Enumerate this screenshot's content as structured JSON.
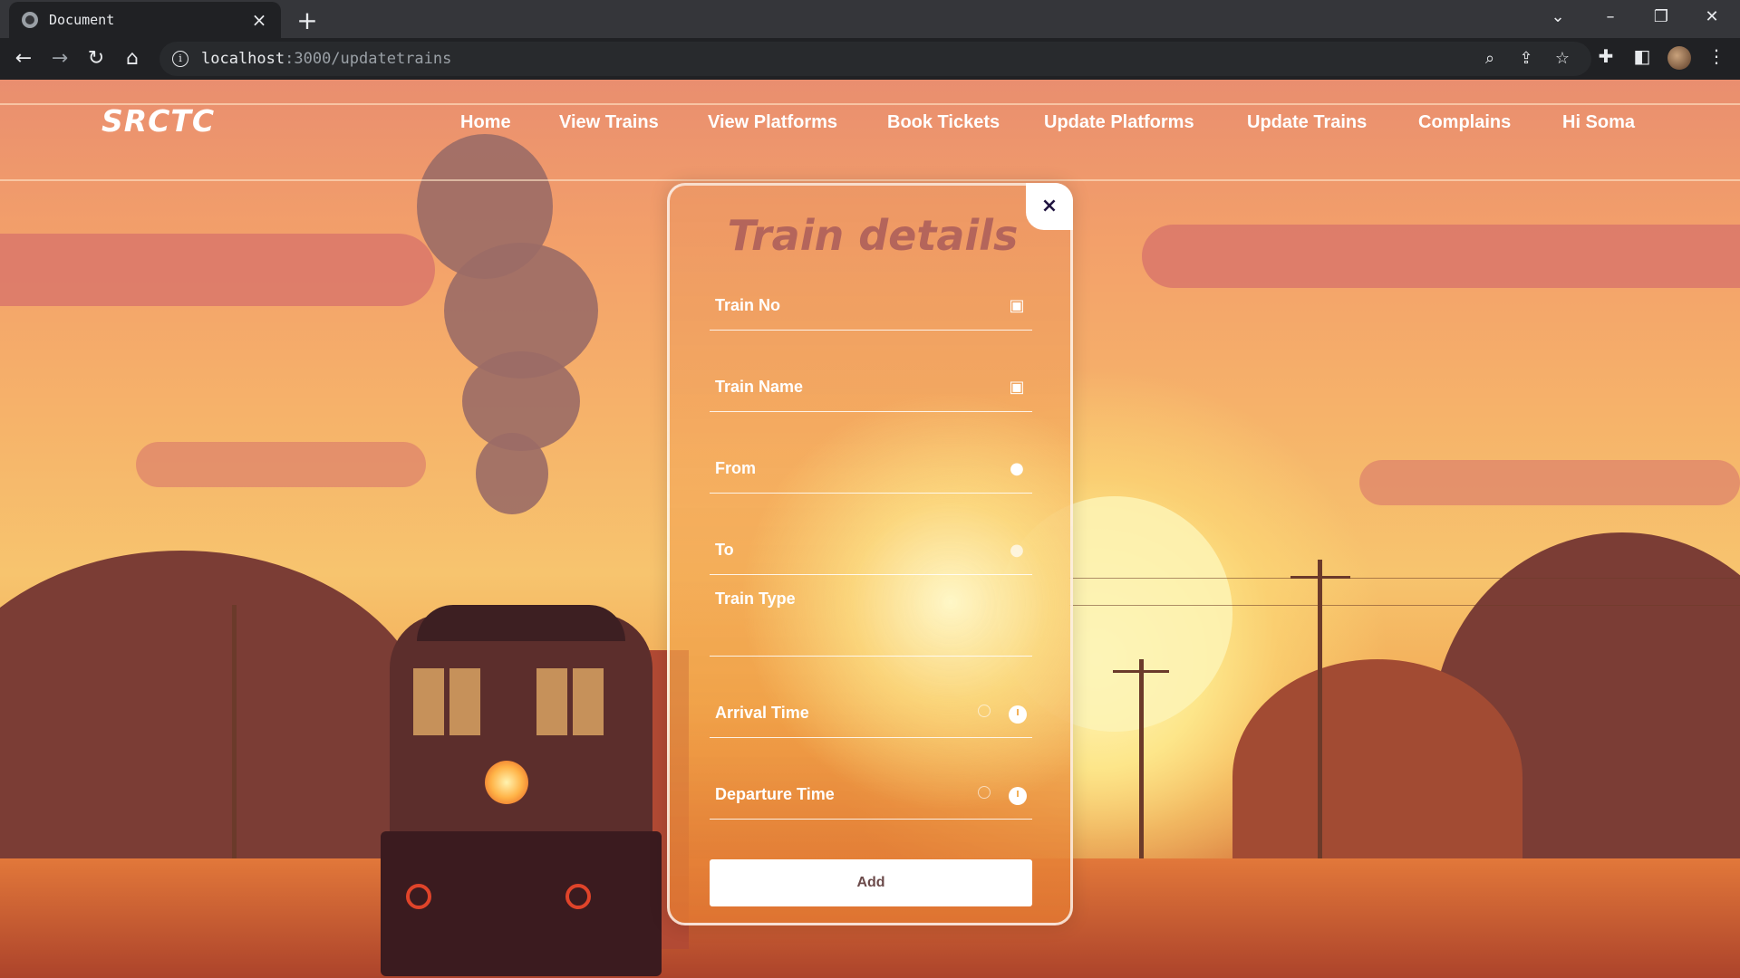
{
  "browser": {
    "tab_title": "Document",
    "tab_close": "×",
    "new_tab": "+",
    "url_host": "localhost",
    "url_path": ":3000/updatetrains"
  },
  "navbar": {
    "logo": "SRCTC",
    "links": [
      "Home",
      "View Trains",
      "View Platforms",
      "Book Tickets",
      "Update Platforms",
      "Update Trains",
      "Complains",
      "Hi Soma"
    ]
  },
  "modal": {
    "title": "Train details",
    "close": "×",
    "fields": [
      {
        "label": "Train No",
        "icon": "bus-icon"
      },
      {
        "label": "Train Name",
        "icon": "bus-icon"
      },
      {
        "label": "From",
        "icon": "location-pin-icon"
      },
      {
        "label": "To",
        "icon": "location-pin-icon"
      },
      {
        "label": "Train Type",
        "icon": ""
      },
      {
        "label": "Arrival Time",
        "icon": "clock-icon"
      },
      {
        "label": "Departure Time",
        "icon": "clock-icon"
      }
    ],
    "submit_label": "Add"
  },
  "colors": {
    "title": "#b4655b",
    "close_text": "#1f1340",
    "chrome_bg": "#202124"
  }
}
